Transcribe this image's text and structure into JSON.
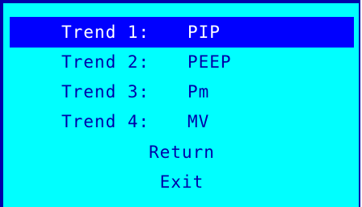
{
  "menu": {
    "trends": [
      {
        "label": "Trend 1:",
        "value": "PIP"
      },
      {
        "label": "Trend 2:",
        "value": "PEEP"
      },
      {
        "label": "Trend 3:",
        "value": "Pm"
      },
      {
        "label": "Trend 4:",
        "value": "MV"
      }
    ],
    "return_label": "Return",
    "exit_label": "Exit"
  },
  "colors": {
    "background": "#00ffff",
    "text": "#0000a8",
    "selected_bg": "#0000ff",
    "selected_text": "#ffffff"
  }
}
